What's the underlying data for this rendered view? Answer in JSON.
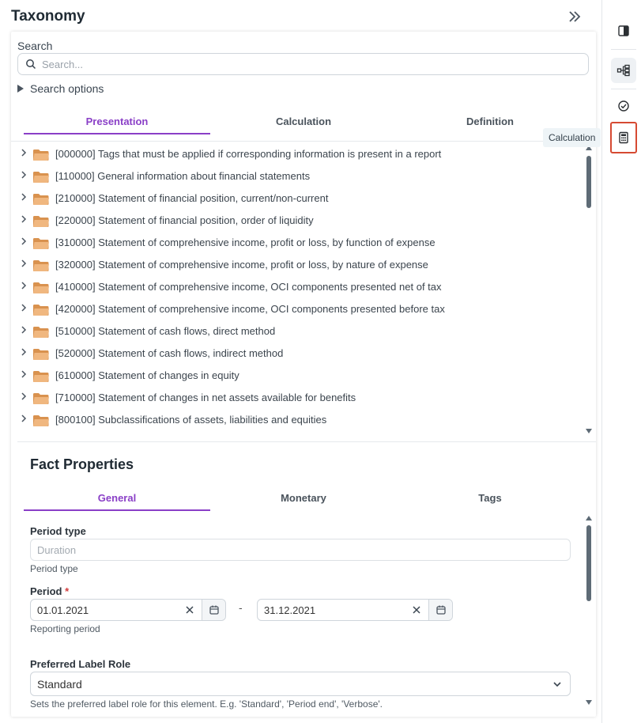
{
  "panel": {
    "title": "Taxonomy"
  },
  "search": {
    "label": "Search",
    "placeholder": "Search...",
    "options_label": "Search options"
  },
  "tabs": [
    {
      "label": "Presentation",
      "active": true
    },
    {
      "label": "Calculation",
      "active": false
    },
    {
      "label": "Definition",
      "active": false
    }
  ],
  "tree": {
    "items": [
      "[000000] Tags that must be applied if corresponding information is present in a report",
      "[110000] General information about financial statements",
      "[210000] Statement of financial position, current/non-current",
      "[220000] Statement of financial position, order of liquidity",
      "[310000] Statement of comprehensive income, profit or loss, by function of expense",
      "[320000] Statement of comprehensive income, profit or loss, by nature of expense",
      "[410000] Statement of comprehensive income, OCI components presented net of tax",
      "[420000] Statement of comprehensive income, OCI components presented before tax",
      "[510000] Statement of cash flows, direct method",
      "[520000] Statement of cash flows, indirect method",
      "[610000] Statement of changes in equity",
      "[710000] Statement of changes in net assets available for benefits",
      "[800100] Subclassifications of assets, liabilities and equities"
    ]
  },
  "fact_properties": {
    "title": "Fact Properties",
    "tabs": [
      {
        "label": "General",
        "active": true
      },
      {
        "label": "Monetary",
        "active": false
      },
      {
        "label": "Tags",
        "active": false
      }
    ],
    "period_type": {
      "label": "Period type",
      "placeholder": "Duration",
      "help": "Period type"
    },
    "period": {
      "label": "Period",
      "required_mark": "*",
      "start": "01.01.2021",
      "end": "31.12.2021",
      "separator": "-",
      "help": "Reporting period"
    },
    "preferred_label_role": {
      "label": "Preferred Label Role",
      "value": "Standard",
      "help": "Sets the preferred label role for this element. E.g. 'Standard', 'Period end', 'Verbose'."
    }
  },
  "rail": {
    "tooltip": "Calculation"
  },
  "colors": {
    "accent": "#8a3fc7",
    "focus": "#d64a32",
    "folder": "#e8a96a"
  }
}
